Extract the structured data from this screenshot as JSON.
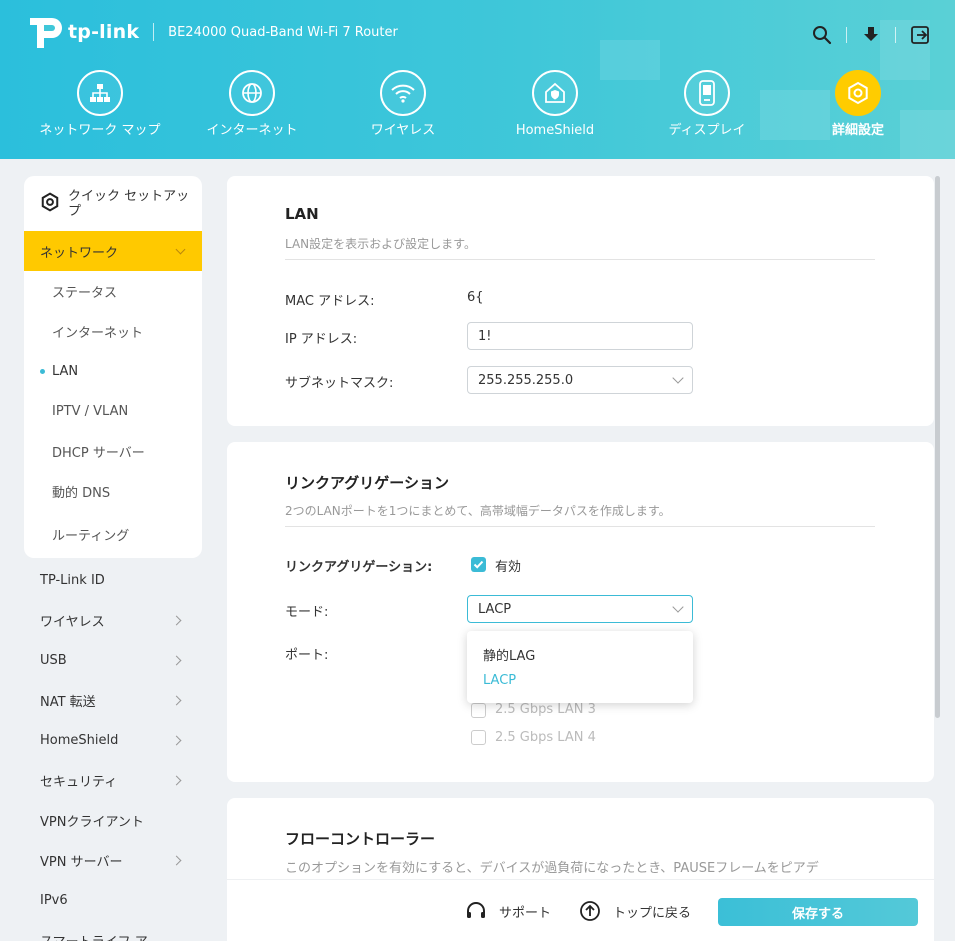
{
  "header": {
    "brand": "tp-link",
    "model": "BE24000 Quad-Band Wi-Fi 7 Router",
    "icons": [
      "search-icon",
      "download-icon",
      "logout-icon"
    ]
  },
  "nav": [
    {
      "label": "ネットワーク マップ",
      "icon": "network-map-icon"
    },
    {
      "label": "インターネット",
      "icon": "globe-icon"
    },
    {
      "label": "ワイヤレス",
      "icon": "wifi-icon"
    },
    {
      "label": "HomeShield",
      "icon": "homeshield-icon"
    },
    {
      "label": "ディスプレイ",
      "icon": "display-icon"
    },
    {
      "label": "詳細設定",
      "icon": "gear-icon",
      "active": true
    }
  ],
  "sidebar": {
    "quick_setup": "クイック セットアップ",
    "network": "ネットワーク",
    "network_sub": [
      "ステータス",
      "インターネット",
      "LAN",
      "IPTV / VLAN",
      "DHCP サーバー",
      "動的 DNS",
      "ルーティング"
    ],
    "network_current": "LAN",
    "items": [
      "TP-Link ID",
      "ワイヤレス",
      "USB",
      "NAT 転送",
      "HomeShield",
      "セキュリティ",
      "VPNクライアント",
      "VPN サーバー",
      "IPv6",
      "スマートライフ ア"
    ]
  },
  "lan": {
    "title": "LAN",
    "desc": "LAN設定を表示および設定します。",
    "mac_label": "MAC アドレス:",
    "mac_value": "6{",
    "ip_label": "IP アドレス:",
    "ip_value": "1!",
    "subnet_label": "サブネットマスク:",
    "subnet_value": "255.255.255.0"
  },
  "link_agg": {
    "title": "リンクアグリゲーション",
    "desc": "2つのLANポートを1つにまとめて、高帯域幅データパスを作成します。",
    "enable_label": "リンクアグリゲーション:",
    "enable_text": "有効",
    "mode_label": "モード:",
    "mode_value": "LACP",
    "port_label": "ポート:",
    "options": [
      "静的LAG",
      "LACP"
    ],
    "ports": [
      "2.5 Gbps LAN 3",
      "2.5 Gbps LAN 4"
    ]
  },
  "flow": {
    "title": "フローコントローラー",
    "desc": "このオプションを有効にすると、デバイスが過負荷になったとき、PAUSEフレームをピアデ"
  },
  "footer": {
    "support": "サポート",
    "top": "トップに戻る",
    "save": "保存する"
  },
  "colors": {
    "accent": "#3bbbd6",
    "active_nav": "#ffcc00",
    "sidebar_active": "#ffc900"
  }
}
